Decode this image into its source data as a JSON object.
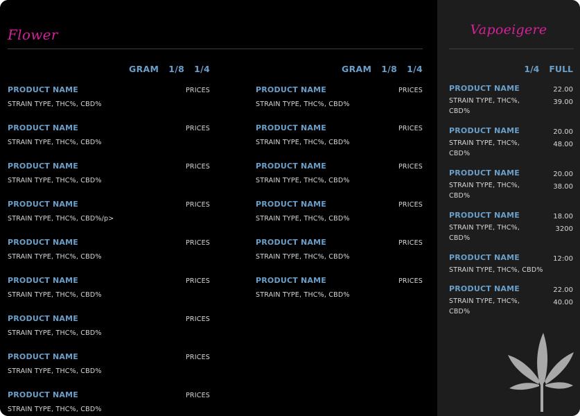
{
  "flower": {
    "title": "Flower",
    "headers": [
      "GRAM",
      "1/8",
      "1/4"
    ],
    "col1": [
      {
        "name": "PRODUCT NAME",
        "info": "STRAIN TYPE, THC%, CBD%",
        "price": "PRICES"
      },
      {
        "name": "PRODUCT NAME",
        "info": "STRAIN TYPE, THC%, CBD%",
        "price": "PRICES"
      },
      {
        "name": "PRODUCT NAME",
        "info": "STRAIN TYPE, THC%, CBD%",
        "price": "PRICES"
      },
      {
        "name": "PRODUCT NAME",
        "info": "STRAIN TYPE, THC%, CBD%/p>",
        "price": "PRICES"
      },
      {
        "name": "PRODUCT NAME",
        "info": "STRAIN TYPE, THC%, CBD%",
        "price": "PRICES"
      },
      {
        "name": "PRODUCT NAME",
        "info": "STRAIN TYPE, THC%, CBD%",
        "price": "PRICES"
      },
      {
        "name": "PRODUCT NAME",
        "info": "STRAIN TYPE, THC%, CBD%",
        "price": "PRICES"
      },
      {
        "name": "PRODUCT NAME",
        "info": "STRAIN TYPE, THC%, CBD%",
        "price": "PRICES"
      },
      {
        "name": "PRODUCT NAME",
        "info": "STRAIN TYPE, THC%, CBD%",
        "price": "PRICES"
      }
    ],
    "col2": [
      {
        "name": "PRODUCT NAME",
        "info": "STRAIN TYPE, THC%, CBD%",
        "price": "PRICES"
      },
      {
        "name": "PRODUCT NAME",
        "info": "STRAIN TYPE, THC%, CBD%",
        "price": "PRICES"
      },
      {
        "name": "PRODUCT NAME",
        "info": "STRAIN TYPE, THC%, CBD%",
        "price": "PRICES"
      },
      {
        "name": "PRODUCT NAME",
        "info": "STRAIN TYPE, THC%, CBD%",
        "price": "PRICES"
      },
      {
        "name": "PRODUCT NAME",
        "info": "STRAIN TYPE, THC%, CBD%",
        "price": "PRICES"
      },
      {
        "name": "PRODUCT NAME",
        "info": "STRAIN TYPE, THC%, CBD%",
        "price": "PRICES"
      }
    ]
  },
  "vape": {
    "title": "Vapoeigere",
    "headers": [
      "1/4",
      "FULL"
    ],
    "items": [
      {
        "name": "PRODUCT NAME",
        "info": "STRAIN TYPE, THC%, CBD%",
        "prices": [
          "22.00",
          "39.00"
        ],
        "info_width": 110
      },
      {
        "name": "PRODUCT NAME",
        "info": "STRAIN TYPE, THC%, CBD%",
        "prices": [
          "20.00",
          "48.00"
        ],
        "info_width": 110
      },
      {
        "name": "PRODUCT NAME",
        "info": "STRAIN TYPE, THC%, CBD%",
        "prices": [
          "20.00",
          "38.00"
        ],
        "info_width": 110
      },
      {
        "name": "PRODUCT NAME",
        "info": "STRAIN TYPE, THC%, CBD%",
        "prices": [
          "18.00",
          "3200"
        ],
        "info_width": 110
      },
      {
        "name": "PRODUCT NAME",
        "info": "STRAIN TYPE, THC%, CBD%",
        "prices": [
          "12:00"
        ],
        "info_width": 150
      },
      {
        "name": "PRODUCT NAME",
        "info": "STRAIN TYPE, THC%, CBD%",
        "prices": [
          "22.00",
          "40.00"
        ],
        "info_width": 110
      }
    ]
  },
  "decor": {
    "icon": "cannabis-leaf-icon",
    "leaf_color": "#a9a9a9",
    "accent": "#d6219a",
    "name_color": "#6a9fc9"
  }
}
